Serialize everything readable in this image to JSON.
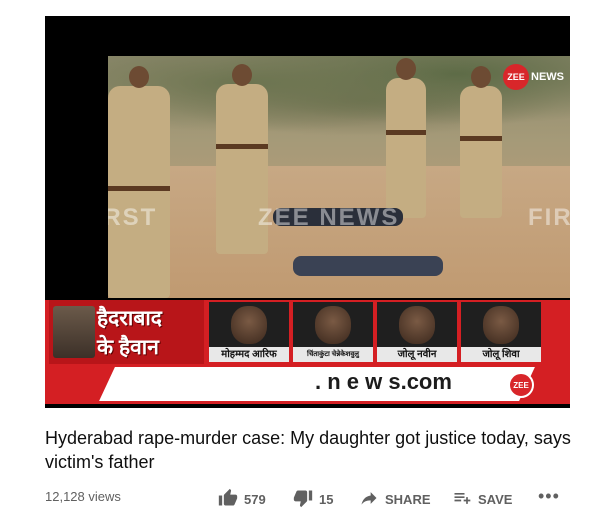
{
  "video": {
    "watermark_left": "FIRST",
    "watermark_mid": "ZEE NEWS",
    "watermark_right": "FIRS",
    "channel_logo": "ZEE",
    "channel_logo_text": "NEWS",
    "banner_line1": "हैदराबाद",
    "banner_line2": "के हैवान",
    "suspects": [
      "मोहम्मद आरिफ",
      "चिंताकुंटा चेन्नेकेशवुलु",
      "जोलू नवीन",
      "जोलू शिवा"
    ],
    "ticker_url": ". n e w s.com",
    "ticker_logo": "ZEE"
  },
  "title": "Hyderabad rape-murder case: My daughter got justice today, says victim's father",
  "meta": {
    "views": "12,128 views",
    "likes": "579",
    "dislikes": "15",
    "share_label": "SHARE",
    "save_label": "SAVE",
    "more_label": "•••"
  },
  "icons": {
    "like": "thumbs-up-icon",
    "dislike": "thumbs-down-icon",
    "share": "share-arrow-icon",
    "save": "playlist-add-icon",
    "more": "more-horizontal-icon"
  },
  "colors": {
    "brand_red": "#d41f23",
    "text_primary": "#0f0f0f",
    "text_secondary": "#606060"
  }
}
